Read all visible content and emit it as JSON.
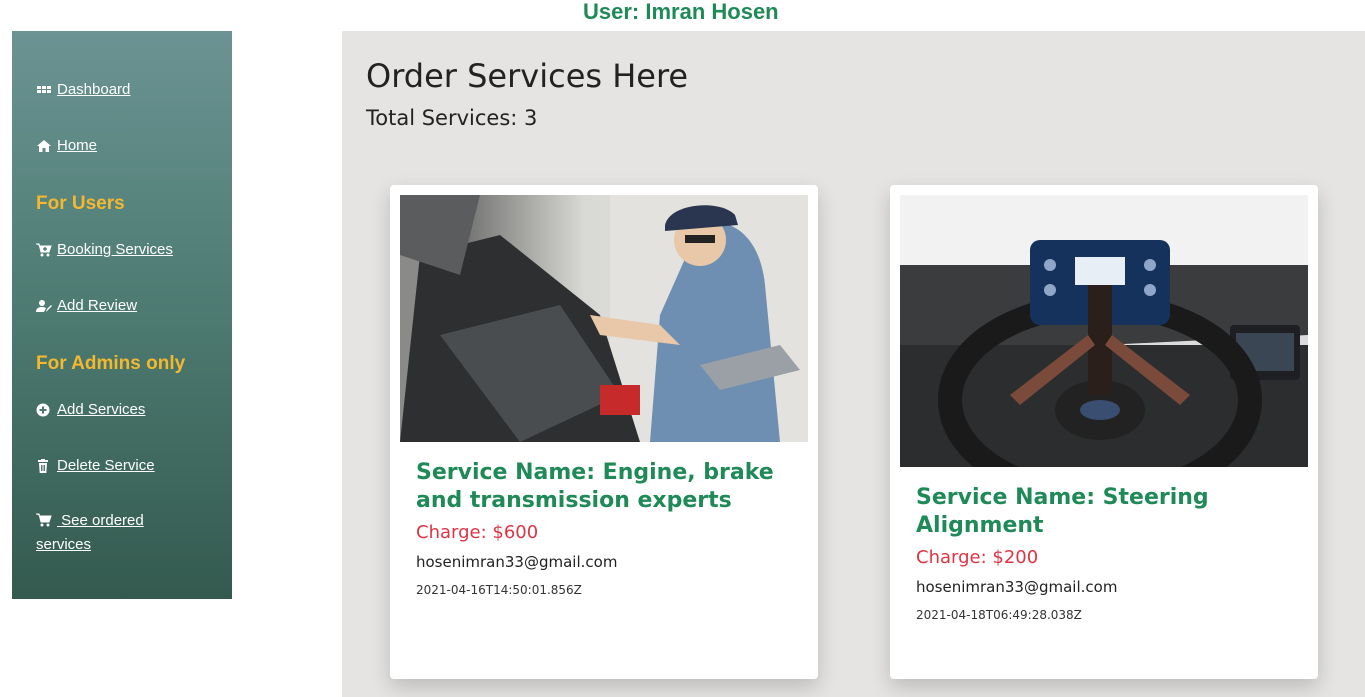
{
  "header": {
    "user_label": "User: Imran Hosen"
  },
  "sidebar": {
    "items": [
      {
        "label": " Dashboard",
        "icon": "dashboard-grid-icon"
      },
      {
        "label": " Home",
        "icon": "home-icon"
      },
      {
        "label": " Booking Services",
        "icon": "cart-plus-icon"
      },
      {
        "label": " Add Review",
        "icon": "user-edit-icon"
      },
      {
        "label": " Add Services",
        "icon": "plus-circle-icon"
      },
      {
        "label": " Delete Service",
        "icon": "trash-icon"
      },
      {
        "label": " See ordered services",
        "icon": "cart-icon"
      }
    ],
    "sections": {
      "users": "For Users",
      "admins": "For Admins only"
    }
  },
  "main": {
    "title": "Order Services Here",
    "total_label": "Total Services: 3",
    "cards": [
      {
        "name": "Service Name: Engine, brake and transmission experts",
        "charge": "Charge: $600",
        "email": "hosenimran33@gmail.com",
        "date": "2021-04-16T14:50:01.856Z",
        "image": "mechanic-engine-photo"
      },
      {
        "name": "Service Name: Steering Alignment",
        "charge": "Charge: $200",
        "email": "hosenimran33@gmail.com",
        "date": "2021-04-18T06:49:28.038Z",
        "image": "steering-wheel-alignment-photo"
      }
    ]
  },
  "colors": {
    "accent_green": "#1f8a57",
    "charge_red": "#dc3545",
    "section_yellow": "#f4b82f",
    "main_bg": "#e5e4e2"
  }
}
